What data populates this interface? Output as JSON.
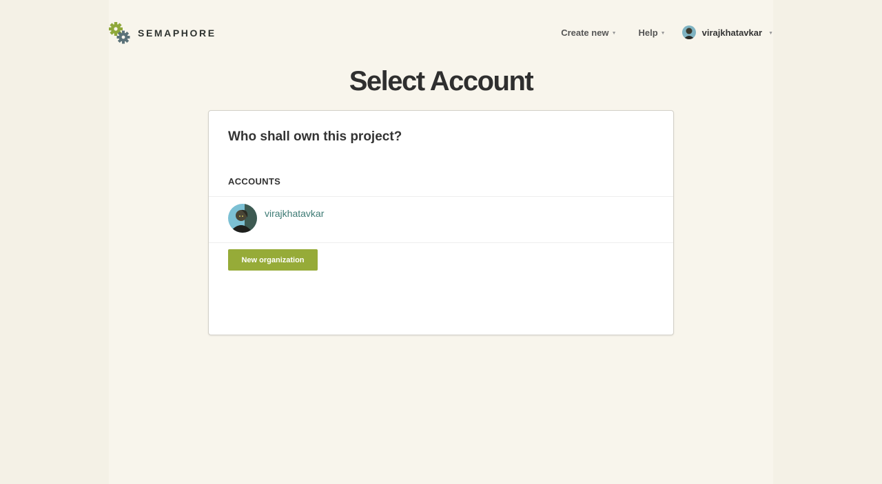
{
  "app": {
    "logo_text": "SEMAPHORE"
  },
  "nav": {
    "create_new": "Create new",
    "help": "Help",
    "username": "virajkhatavkar"
  },
  "page": {
    "title": "Select Account"
  },
  "card": {
    "question": "Who shall own this project?",
    "accounts_label": "ACCOUNTS",
    "accounts": [
      {
        "name": "virajkhatavkar"
      }
    ],
    "new_org_label": "New organization"
  },
  "colors": {
    "page_background": "#f4f1e6",
    "brand_green": "#96ab38",
    "logo_gray": "#5b7279",
    "link_teal": "#3d7a74"
  }
}
